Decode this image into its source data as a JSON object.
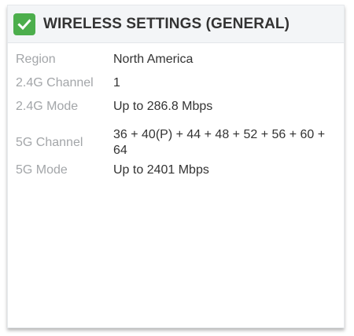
{
  "panel": {
    "title": "WIRELESS SETTINGS (GENERAL)",
    "status_icon": "checkmark-icon",
    "accent_color": "#4cae4c"
  },
  "settings": [
    {
      "label": "Region",
      "value": "North America"
    },
    {
      "label": "2.4G Channel",
      "value": "1"
    },
    {
      "label": "2.4G Mode",
      "value": "Up to 286.8 Mbps"
    },
    {
      "label": "5G Channel",
      "value": "36 + 40(P) + 44 + 48 + 52 + 56 + 60 + 64"
    },
    {
      "label": "5G Mode",
      "value": "Up to 2401 Mbps"
    }
  ]
}
